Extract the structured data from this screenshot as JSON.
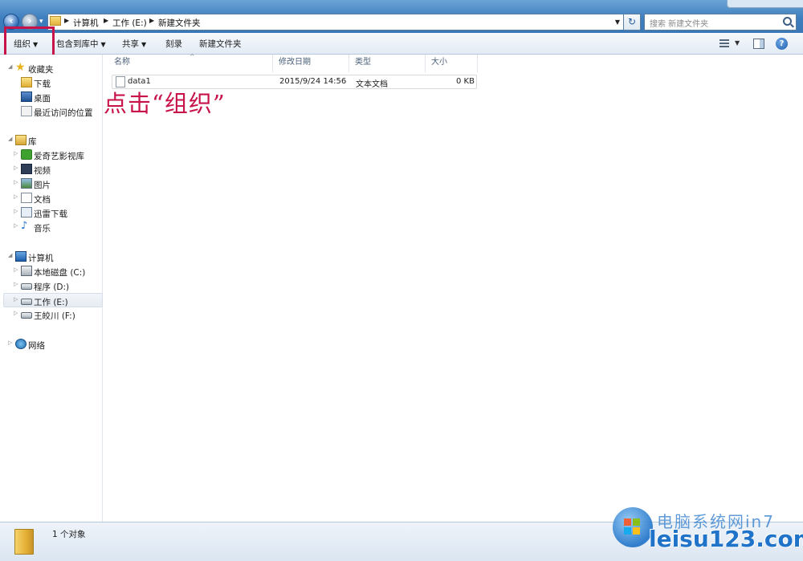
{
  "address": {
    "crumbs": [
      "计算机",
      "工作 (E:)",
      "新建文件夹"
    ],
    "search_placeholder": "搜索 新建文件夹"
  },
  "toolbar": {
    "organize": "组织",
    "include_library": "包含到库中",
    "share": "共享",
    "burn": "刻录",
    "new_folder": "新建文件夹"
  },
  "navpane": {
    "favorites": "收藏夹",
    "downloads": "下载",
    "desktop": "桌面",
    "recent": "最近访问的位置",
    "libraries": "库",
    "iqiyi": "爱奇艺影视库",
    "videos": "视频",
    "pictures": "图片",
    "documents": "文档",
    "xunlei": "迅雷下载",
    "music": "音乐",
    "computer": "计算机",
    "drive_c": "本地磁盘 (C:)",
    "drive_d": "程序 (D:)",
    "drive_e": "工作 (E:)",
    "drive_f": "王皎川 (F:)",
    "network": "网络"
  },
  "columns": {
    "name": "名称",
    "modified": "修改日期",
    "type": "类型",
    "size": "大小"
  },
  "files": [
    {
      "name": "data1",
      "modified": "2015/9/24 14:56",
      "type": "文本文档",
      "size": "0 KB"
    }
  ],
  "annotation": "点击“组织”",
  "status": {
    "count": "1 个对象"
  },
  "watermark": {
    "cn": "电脑系统网",
    "site": "leisu123.com",
    "suffix": "in7"
  },
  "colors": {
    "highlight": "#c8134a",
    "titlebar": "#3f7fbf"
  }
}
